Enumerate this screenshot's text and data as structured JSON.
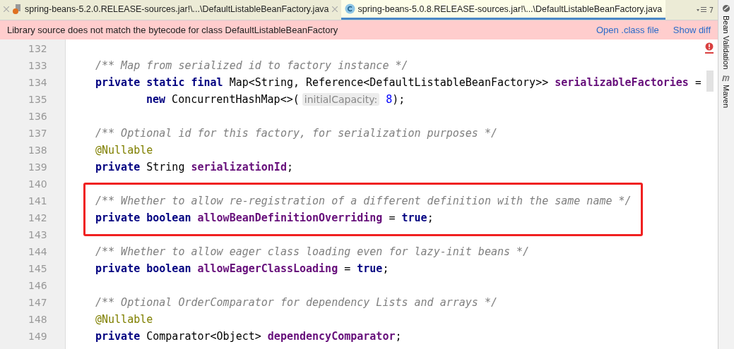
{
  "tabs": [
    {
      "label": "spring-beans-5.2.0.RELEASE-sources.jar!\\...\\DefaultListableBeanFactory.java",
      "selected": false
    },
    {
      "label": "spring-beans-5.0.8.RELEASE-sources.jar!\\...\\DefaultListableBeanFactory.java",
      "selected": true
    }
  ],
  "tab_overflow": "7",
  "banner": {
    "message": "Library source does not match the bytecode for class DefaultListableBeanFactory",
    "links": [
      "Open .class file",
      "Show diff"
    ]
  },
  "side_tools": [
    "Bean Validation",
    "Maven"
  ],
  "lines": [
    {
      "number": "132",
      "highlighted": false
    },
    {
      "number": "133",
      "highlighted": false,
      "tokens": [
        {
          "kind": "comment",
          "text": "/** Map from serialized id to factory instance */"
        }
      ]
    },
    {
      "number": "134",
      "highlighted": false,
      "tokens": [
        {
          "kind": "keyword",
          "text": "private static final"
        },
        {
          "kind": "plain",
          "text": " Map<String, Reference<DefaultListableBeanFactory>> "
        },
        {
          "kind": "field",
          "text": "serializableFactories"
        },
        {
          "kind": "plain",
          "text": " ="
        }
      ]
    },
    {
      "number": "135",
      "highlighted": false,
      "continuation": true,
      "tokens": [
        {
          "kind": "keyword",
          "text": "new"
        },
        {
          "kind": "plain",
          "text": " ConcurrentHashMap<>("
        },
        {
          "kind": "hint",
          "text": "initialCapacity:"
        },
        {
          "kind": "number",
          "text": " 8"
        },
        {
          "kind": "plain",
          "text": ");"
        }
      ]
    },
    {
      "number": "136",
      "highlighted": false
    },
    {
      "number": "137",
      "highlighted": false,
      "tokens": [
        {
          "kind": "comment",
          "text": "/** Optional id for this factory, for serialization purposes */"
        }
      ]
    },
    {
      "number": "138",
      "highlighted": false,
      "tokens": [
        {
          "kind": "annotation",
          "text": "@Nullable"
        }
      ]
    },
    {
      "number": "139",
      "highlighted": false,
      "tokens": [
        {
          "kind": "keyword",
          "text": "private"
        },
        {
          "kind": "plain",
          "text": " String "
        },
        {
          "kind": "field",
          "text": "serializationId"
        },
        {
          "kind": "plain",
          "text": ";"
        }
      ]
    },
    {
      "number": "140",
      "highlighted": false
    },
    {
      "number": "141",
      "highlighted": true,
      "tokens": [
        {
          "kind": "comment",
          "text": "/** Whether to allow re-registration of a different definition with the same name */"
        }
      ]
    },
    {
      "number": "142",
      "highlighted": true,
      "tokens": [
        {
          "kind": "keyword",
          "text": "private boolean "
        },
        {
          "kind": "field",
          "text": "allowBeanDefinitionOverriding"
        },
        {
          "kind": "plain",
          "text": " = "
        },
        {
          "kind": "keyword",
          "text": "true"
        },
        {
          "kind": "plain",
          "text": ";"
        }
      ]
    },
    {
      "number": "143",
      "highlighted": false
    },
    {
      "number": "144",
      "highlighted": false,
      "tokens": [
        {
          "kind": "comment",
          "text": "/** Whether to allow eager class loading even for lazy-init beans */"
        }
      ]
    },
    {
      "number": "145",
      "highlighted": false,
      "tokens": [
        {
          "kind": "keyword",
          "text": "private boolean "
        },
        {
          "kind": "field",
          "text": "allowEagerClassLoading"
        },
        {
          "kind": "plain",
          "text": " = "
        },
        {
          "kind": "keyword",
          "text": "true"
        },
        {
          "kind": "plain",
          "text": ";"
        }
      ]
    },
    {
      "number": "146",
      "highlighted": false
    },
    {
      "number": "147",
      "highlighted": false,
      "tokens": [
        {
          "kind": "comment",
          "text": "/** Optional OrderComparator for dependency Lists and arrays */"
        }
      ]
    },
    {
      "number": "148",
      "highlighted": false,
      "tokens": [
        {
          "kind": "annotation",
          "text": "@Nullable"
        }
      ]
    },
    {
      "number": "149",
      "highlighted": false,
      "tokens": [
        {
          "kind": "keyword",
          "text": "private"
        },
        {
          "kind": "plain",
          "text": " Comparator<Object> "
        },
        {
          "kind": "field",
          "text": "dependencyComparator"
        },
        {
          "kind": "plain",
          "text": ";"
        }
      ]
    }
  ]
}
